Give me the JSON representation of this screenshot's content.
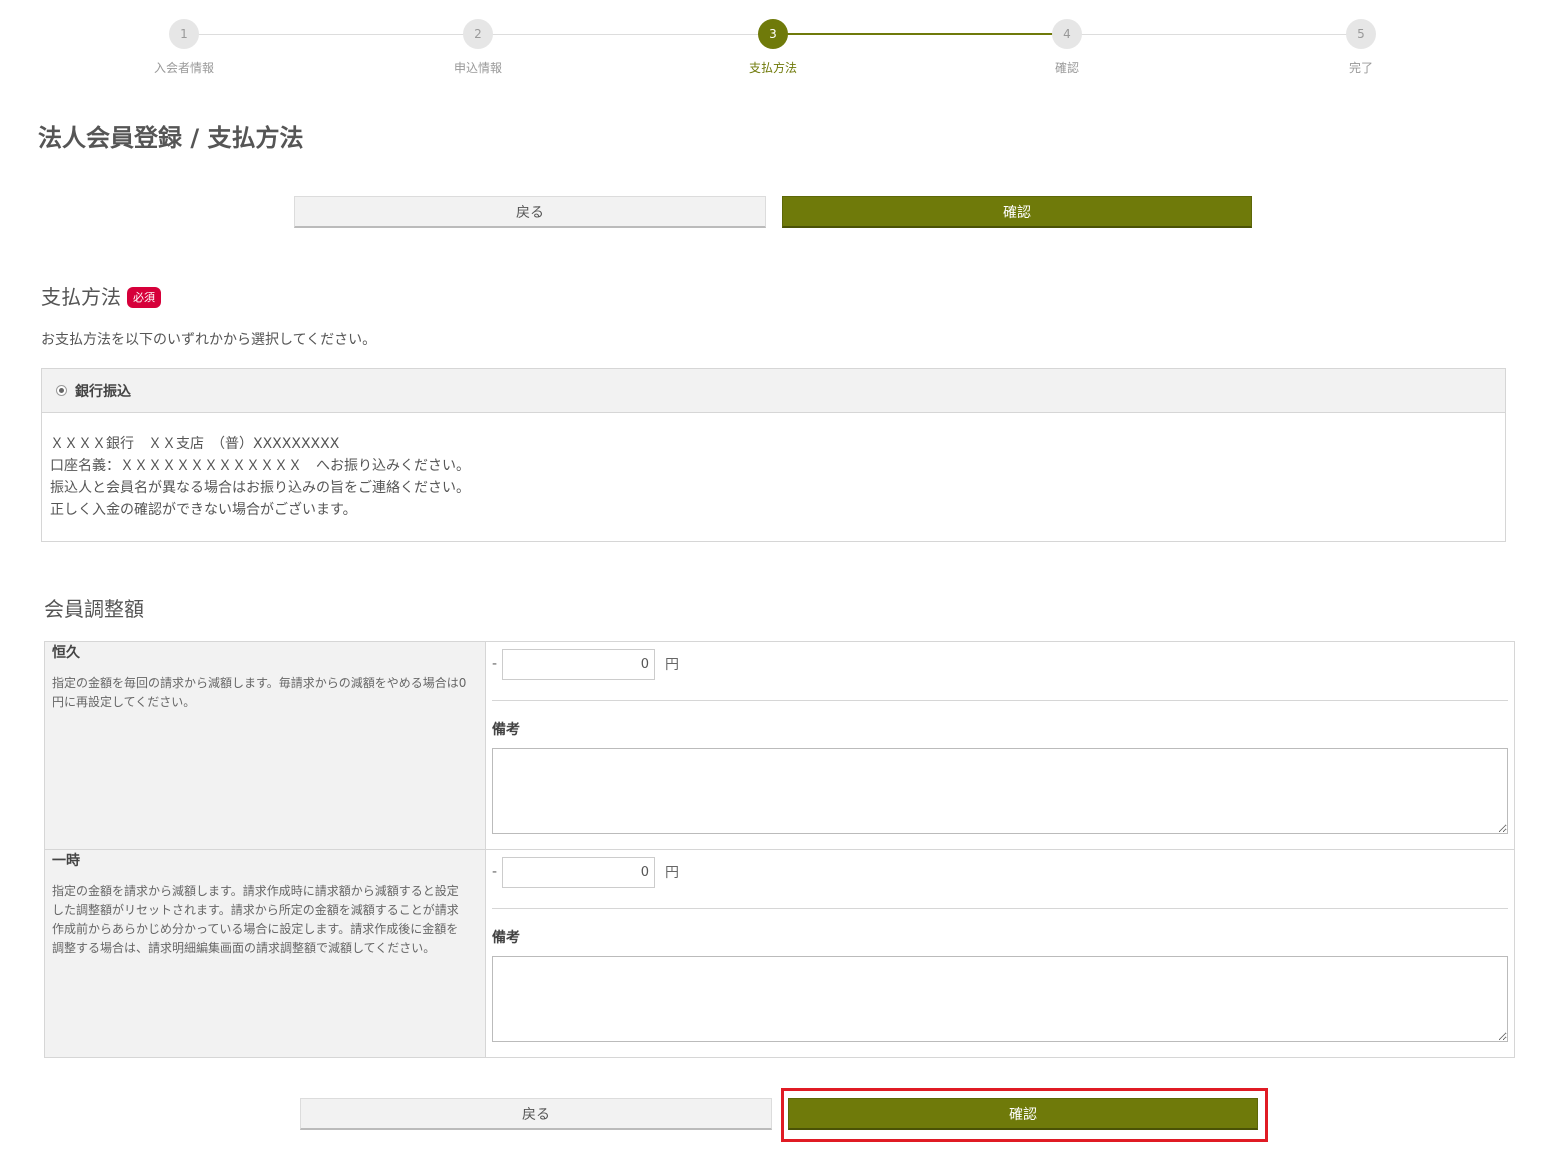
{
  "stepper": {
    "steps": [
      {
        "number": "1",
        "label": "入会者情報"
      },
      {
        "number": "2",
        "label": "申込情報"
      },
      {
        "number": "3",
        "label": "支払方法"
      },
      {
        "number": "4",
        "label": "確認"
      },
      {
        "number": "5",
        "label": "完了"
      }
    ],
    "current": 3,
    "accent_color": "#6f7a0a"
  },
  "page": {
    "title": "法人会員登録 / 支払方法"
  },
  "actions": {
    "back_label": "戻る",
    "confirm_label": "確認"
  },
  "payment": {
    "title": "支払方法",
    "required_badge": "必須",
    "required_color": "#d6003a",
    "description": "お支払方法を以下のいずれかから選択してください。",
    "method_label": "銀行振込",
    "details": [
      "ＸＸＸＸ銀行　ＸＸ支店　（普）XXXXXXXXX",
      "口座名義：ＸＸＸＸＸＸＸＸＸＸＸＸＸ　へお振り込みください。",
      "振込人と会員名が異なる場合はお振り込みの旨をご連絡ください。",
      "正しく入金の確認ができない場合がございます。"
    ]
  },
  "adjustment": {
    "title": "会員調整額",
    "rows": [
      {
        "label": "恒久",
        "description": "指定の金額を毎回の請求から減額します。毎請求からの減額をやめる場合は0円に再設定してください。",
        "sign": "-",
        "amount": "0",
        "unit": "円",
        "remarks_label": "備考",
        "remarks_value": ""
      },
      {
        "label": "一時",
        "description": "指定の金額を請求から減額します。請求作成時に請求額から減額すると設定した調整額がリセットされます。請求から所定の金額を減額することが請求作成前からあらかじめ分かっている場合に設定します。請求作成後に金額を調整する場合は、請求明細編集画面の請求調整額で減額してください。",
        "sign": "-",
        "amount": "0",
        "unit": "円",
        "remarks_label": "備考",
        "remarks_value": ""
      }
    ]
  }
}
